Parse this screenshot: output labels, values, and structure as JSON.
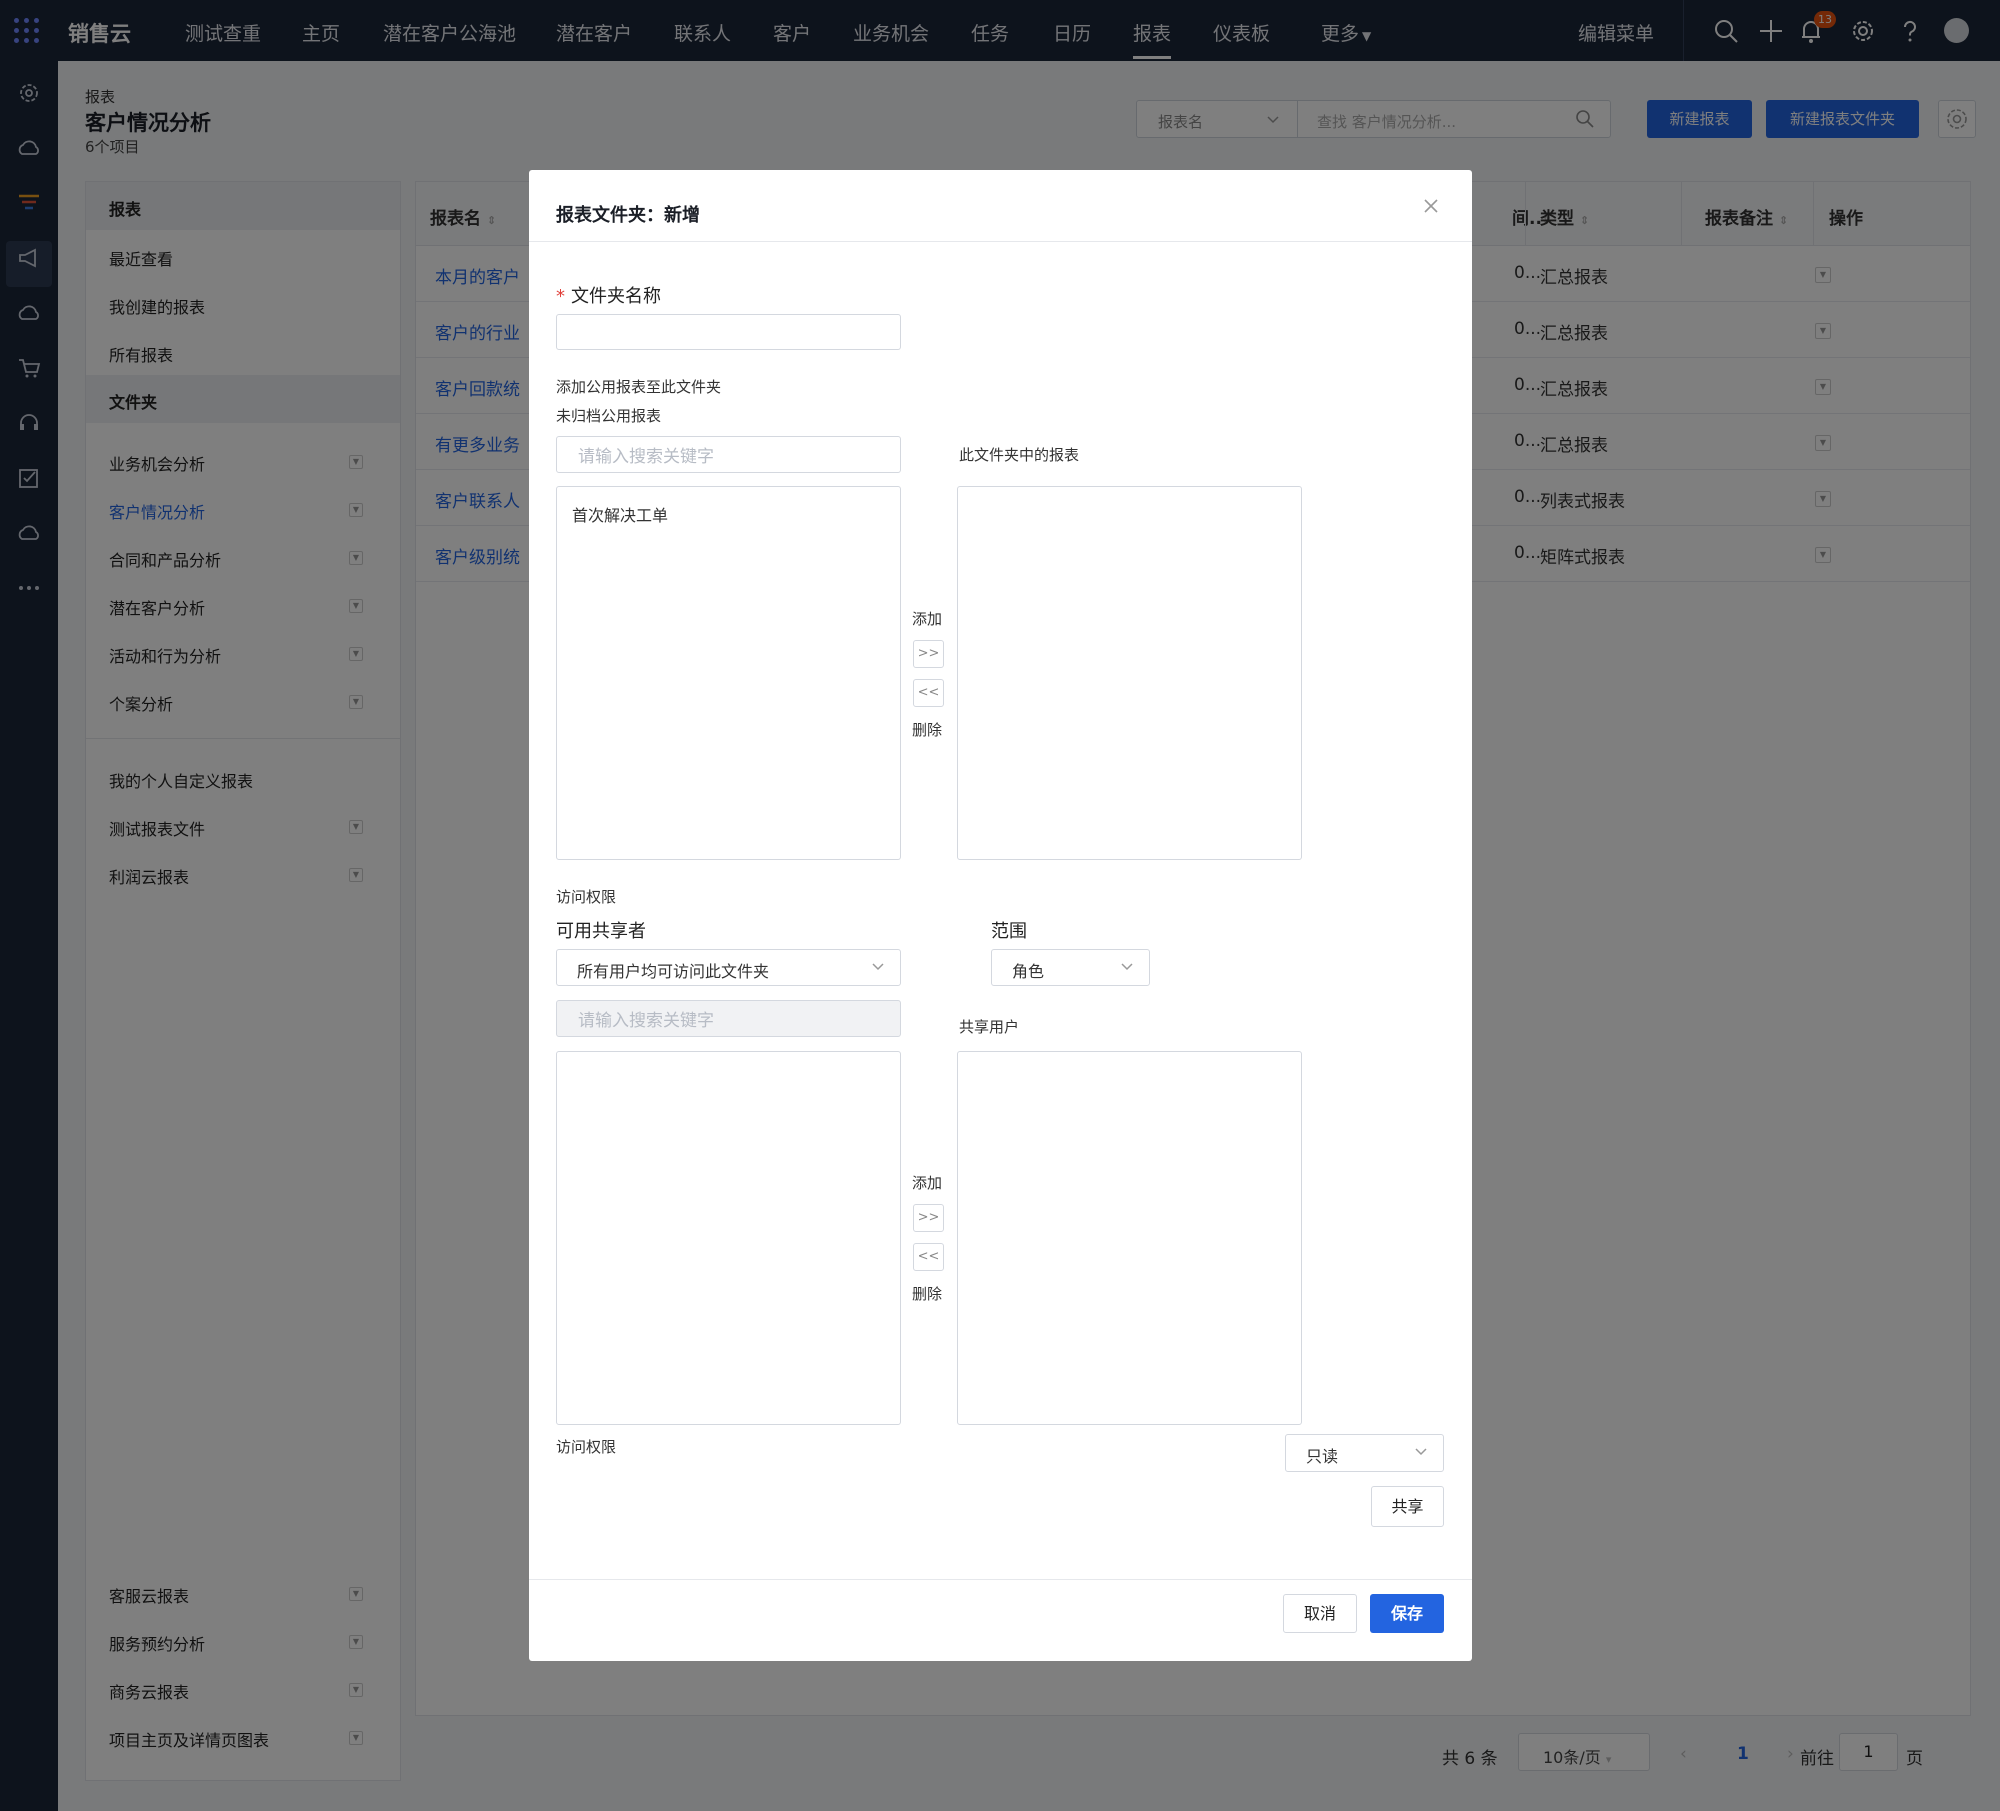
{
  "topbar": {
    "brand": "销售云",
    "nav": [
      "测试查重",
      "主页",
      "潜在客户公海池",
      "潜在客户",
      "联系人",
      "客户",
      "业务机会",
      "任务",
      "日历",
      "报表",
      "仪表板",
      "更多"
    ],
    "active_nav": "报表",
    "edit_menu": "编辑菜单",
    "notification_count": "13",
    "colors": {
      "bar": "#1b2638",
      "accent": "#2364e0",
      "badge": "#e8530e"
    }
  },
  "header": {
    "breadcrumb": "报表",
    "title": "客户情况分析",
    "item_count": "6个项目",
    "search_scope": "报表名",
    "search_placeholder": "查找 客户情况分析...",
    "new_report": "新建报表",
    "new_report_folder": "新建报表文件夹"
  },
  "sidebar": {
    "section_reports": "报表",
    "recent": "最近查看",
    "my_created": "我创建的报表",
    "all_reports": "所有报表",
    "section_folders": "文件夹",
    "folders": [
      "业务机会分析",
      "客户情况分析",
      "合同和产品分析",
      "潜在客户分析",
      "活动和行为分析",
      "个案分析"
    ],
    "custom": [
      "我的个人自定义报表",
      "测试报表文件",
      "利润云报表"
    ],
    "bottom_folders": [
      "客服云报表",
      "服务预约分析",
      "商务云报表",
      "项目主页及详情页图表"
    ]
  },
  "table": {
    "headers": {
      "name": "报表名",
      "time": "间..",
      "type": "类型",
      "note": "报表备注",
      "action": "操作"
    },
    "rows": [
      {
        "name": "本月的客户",
        "time": "0...",
        "type": "汇总报表"
      },
      {
        "name": "客户的行业",
        "time": "0...",
        "type": "汇总报表"
      },
      {
        "name": "客户回款统",
        "time": "0...",
        "type": "汇总报表"
      },
      {
        "name": "有更多业务",
        "time": "0...",
        "type": "汇总报表"
      },
      {
        "name": "客户联系人",
        "time": "0...",
        "type": "列表式报表"
      },
      {
        "name": "客户级别统",
        "time": "0...",
        "type": "矩阵式报表"
      }
    ]
  },
  "pager": {
    "total": "共 6 条",
    "page_size": "10条/页",
    "current": "1",
    "goto_label": "前往",
    "goto_value": "1",
    "page_unit": "页"
  },
  "modal": {
    "title": "报表文件夹：新增",
    "folder_name_label": "文件夹名称",
    "add_public_label": "添加公用报表至此文件夹",
    "unfiled_label": "未归档公用报表",
    "search_placeholder": "请输入搜索关键字",
    "unfiled_items": [
      "首次解决工单"
    ],
    "in_folder_label": "此文件夹中的报表",
    "add": "添加",
    "add_btn": ">>",
    "remove_btn": "<<",
    "remove": "删除",
    "access_label": "访问权限",
    "sharers_label": "可用共享者",
    "sharers_value": "所有用户均可访问此文件夹",
    "scope_label": "范围",
    "scope_value": "角色",
    "share_search_placeholder": "请输入搜索关键字",
    "shared_users_label": "共享用户",
    "access_label_2": "访问权限",
    "access_value": "只读",
    "share_btn": "共享",
    "cancel": "取消",
    "save": "保存"
  }
}
